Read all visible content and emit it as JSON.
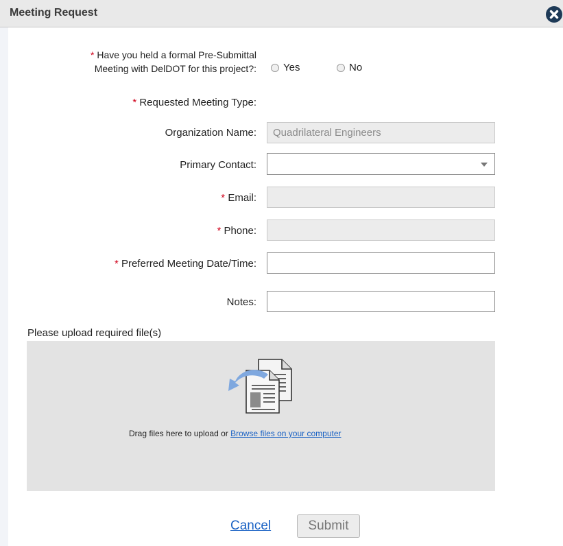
{
  "dialog": {
    "title": "Meeting Request"
  },
  "question": {
    "required_mark": "*",
    "line1": "Have you held a formal Pre-Submittal",
    "line2": "Meeting with DelDOT for this project?:",
    "options": [
      "Yes",
      "No"
    ]
  },
  "meeting_type": {
    "required_mark": "*",
    "label": "Requested Meeting Type:"
  },
  "organization": {
    "label": "Organization Name:",
    "value": "Quadrilateral Engineers"
  },
  "primary_contact": {
    "label": "Primary Contact:",
    "value": ""
  },
  "email": {
    "required_mark": "*",
    "label": "Email:",
    "value": ""
  },
  "phone": {
    "required_mark": "*",
    "label": "Phone:",
    "value": ""
  },
  "preferred_date": {
    "required_mark": "*",
    "label": "Preferred Meeting Date/Time:",
    "value": ""
  },
  "notes": {
    "label": "Notes:",
    "value": ""
  },
  "upload": {
    "label": "Please upload required file(s)",
    "drag_text": "Drag files here to upload or ",
    "browse_link": "Browse files on your computer"
  },
  "actions": {
    "cancel": "Cancel",
    "submit": "Submit"
  },
  "colors": {
    "required": "#d0021b",
    "link": "#1a62c4",
    "close_button": "#1e3a57",
    "dropzone": "#e3e3e3"
  },
  "icons": {
    "close": "close-circle-icon",
    "upload": "document-upload-icon"
  }
}
